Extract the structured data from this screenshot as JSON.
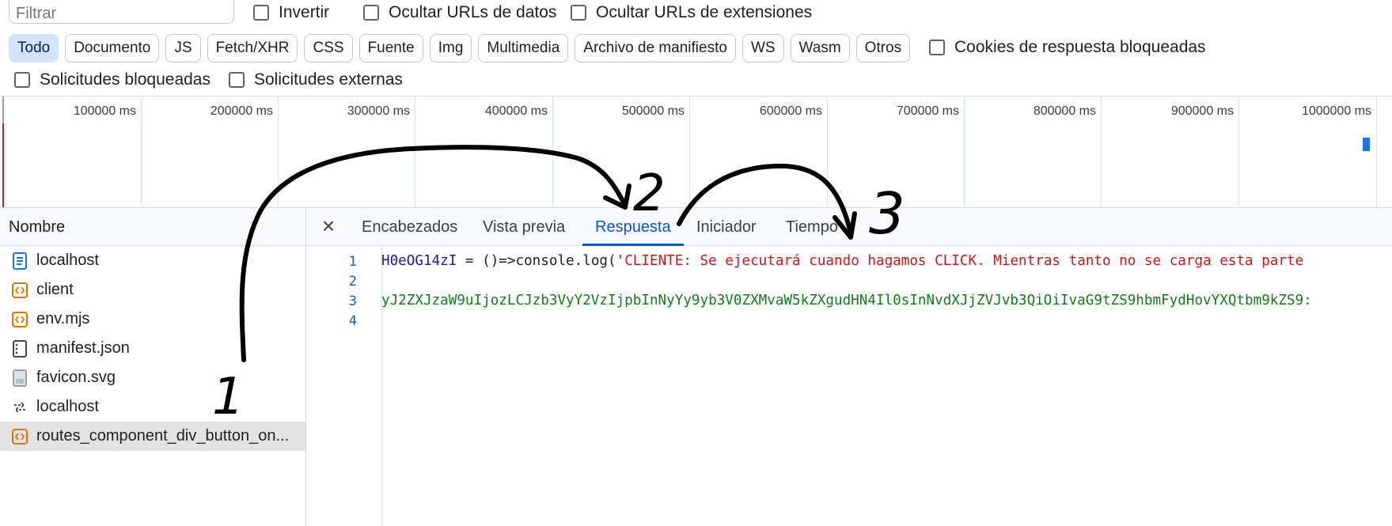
{
  "filter": {
    "placeholder": "Filtrar"
  },
  "checkboxes": {
    "invert": "Invertir",
    "hide_data_urls": "Ocultar URLs de datos",
    "hide_extension_urls": "Ocultar URLs de extensiones",
    "blocked_response_cookies": "Cookies de respuesta bloqueadas",
    "blocked_requests": "Solicitudes bloqueadas",
    "third_party_requests": "Solicitudes externas"
  },
  "types": [
    "Todo",
    "Documento",
    "JS",
    "Fetch/XHR",
    "CSS",
    "Fuente",
    "Img",
    "Multimedia",
    "Archivo de manifiesto",
    "WS",
    "Wasm",
    "Otros"
  ],
  "timeline": {
    "labels": [
      "100000 ms",
      "200000 ms",
      "300000 ms",
      "400000 ms",
      "500000 ms",
      "600000 ms",
      "700000 ms",
      "800000 ms",
      "900000 ms",
      "1000000 ms"
    ]
  },
  "requests": {
    "header": "Nombre",
    "items": [
      {
        "name": "localhost",
        "icon": "document-icon"
      },
      {
        "name": "client",
        "icon": "script-icon"
      },
      {
        "name": "env.mjs",
        "icon": "script-icon"
      },
      {
        "name": "manifest.json",
        "icon": "file-icon"
      },
      {
        "name": "favicon.svg",
        "icon": "image-icon"
      },
      {
        "name": "localhost",
        "icon": "websocket-icon"
      },
      {
        "name": "routes_component_div_button_on...",
        "icon": "script-icon"
      }
    ]
  },
  "detail_tabs": [
    "Encabezados",
    "Vista previa",
    "Respuesta",
    "Iniciador",
    "Tiempo"
  ],
  "code": {
    "line_numbers": [
      "1",
      "2",
      "3",
      "4"
    ],
    "line1_id": "H0eOG14zI",
    "line1_op": " = ()=>console.log(",
    "line1_str": "'CLIENTE: Se ejecutará cuando hagamos CLICK. Mientras tanto no se carga esta parte",
    "line3": "yJ2ZXJzaW9uIjozLCJzb3VyY2VzIjpbInNyYy9yb3V0ZXMvaW5kZXgudHN4Il0sInNvdXJjZVJvb3QiOiIvaG9tZS9hbmFydHovYXQtbm9kZS9:"
  },
  "annotations": [
    "1",
    "2",
    "3"
  ],
  "colors": {
    "accent": "#0b57d0",
    "active_type_bg": "#d3e3fd",
    "selected_row": "#e3e3e3",
    "timeline_bar": "#1a73e8"
  }
}
